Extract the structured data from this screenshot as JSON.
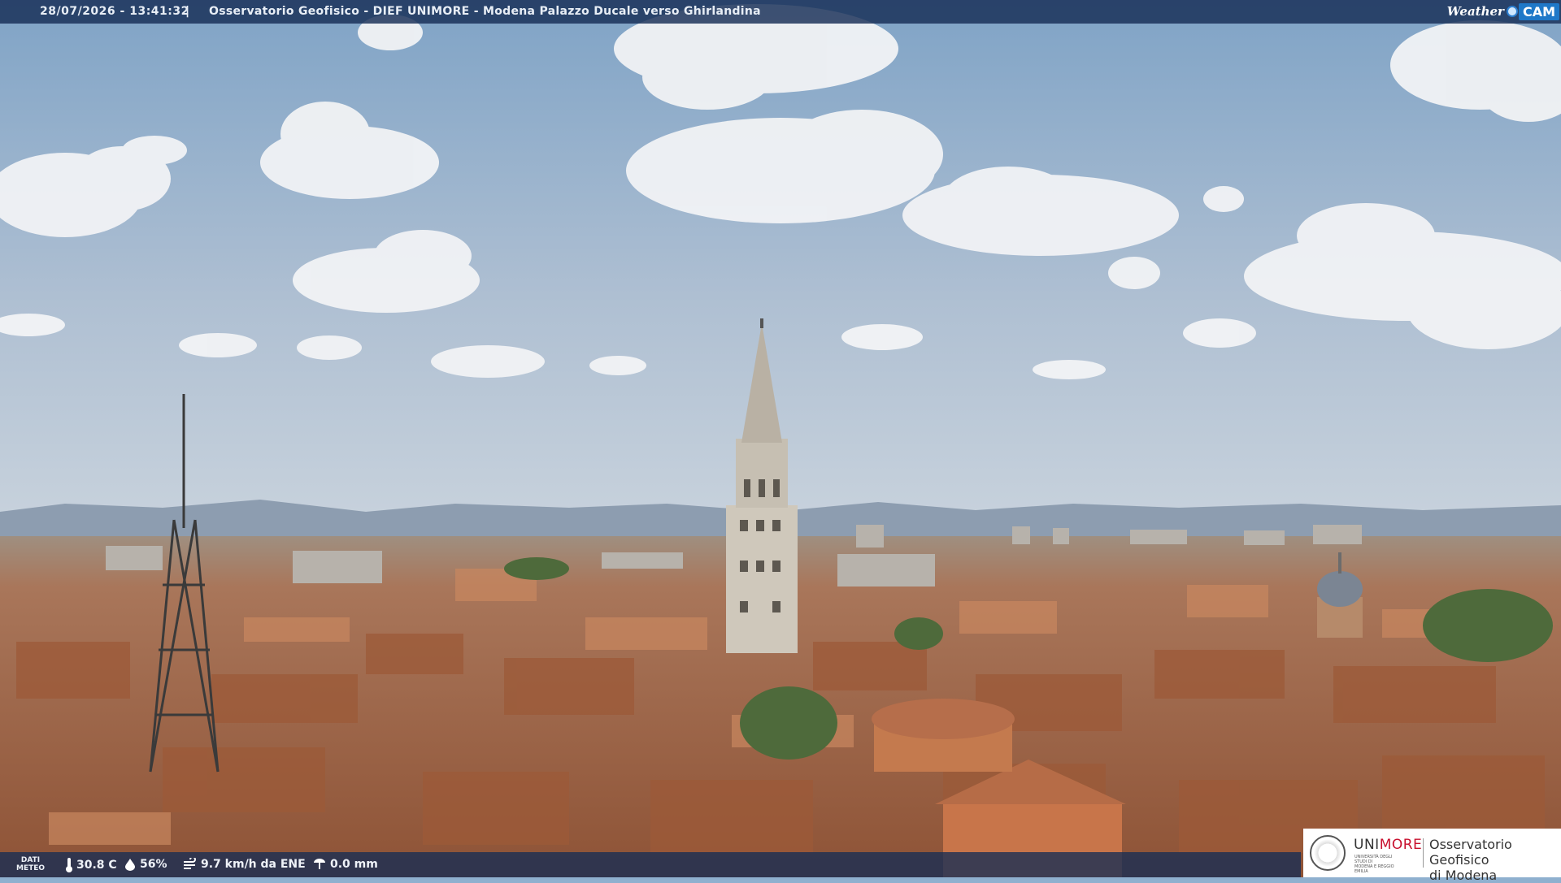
{
  "header": {
    "timestamp": "28/07/2026 - 13:41:32",
    "separator": "|",
    "title": "Osservatorio Geofisico - DIEF UNIMORE - Modena Palazzo Ducale verso Ghirlandina"
  },
  "brand": {
    "weather": "Weather",
    "cam": "CAM"
  },
  "weather_data": {
    "label_line1": "DATI",
    "label_line2": "METEO",
    "temperature": "30.8 C",
    "humidity": "56%",
    "wind": "9.7 km/h da ENE",
    "rain": "0.0 mm"
  },
  "logo": {
    "uni_prefix": "UNI",
    "uni_suffix": "MORE",
    "university_line1": "UNIVERSITÀ DEGLI STUDI DI",
    "university_line2": "MODENA E REGGIO EMILIA",
    "observatory_line1": "Osservatorio Geofisico",
    "observatory_line2": "di Modena"
  },
  "colors": {
    "sky_top": "#7fa3c6",
    "sky_bottom": "#c9d6e2",
    "roof": "#b06a45",
    "tower": "#c9c2b6",
    "bar": "#162d55",
    "accent_red": "#c8102e"
  },
  "icons": [
    "thermometer-icon",
    "humidity-drop-icon",
    "wind-icon",
    "rain-gauge-icon"
  ]
}
